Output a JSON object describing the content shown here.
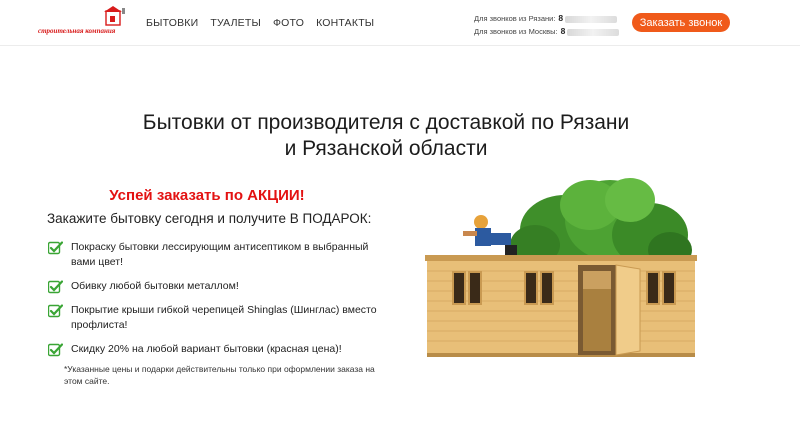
{
  "header": {
    "logo_text": "строительная компания",
    "nav": [
      "БЫТОВКИ",
      "ТУАЛЕТЫ",
      "ФОТО",
      "КОНТАКТЫ"
    ],
    "phones": [
      {
        "label": "Для звонков из Рязани:",
        "number": "8"
      },
      {
        "label": "Для звонков из Москвы:",
        "number": "8"
      }
    ],
    "call_button": "Заказать звонок"
  },
  "main": {
    "title_line1": "Бытовки от производителя с доставкой по Рязани",
    "title_line2": "и Рязанской области",
    "promo_heading": "Успей заказать по АКЦИИ!",
    "promo_sub": "Закажите бытовку сегодня и получите В ПОДАРОК:",
    "benefits": [
      "Покраску бытовки лессирующим антисептиком в выбранный вами цвет!",
      "Обивку любой бытовки металлом!",
      "Покрытие крыши гибкой черепицей Shinglas (Шинглас) вместо профлиста!",
      "Скидку 20% на любой вариант бытовки (красная цена)!"
    ],
    "note": "*Указанные цены и подарки действительны только при оформлении заказа на этом сайте."
  },
  "colors": {
    "accent": "#f05a1a",
    "promo_red": "#e31212",
    "check_green": "#3aa535",
    "wood": "#e8bf78"
  },
  "icons": [
    "logo-house-icon",
    "check-icon"
  ]
}
